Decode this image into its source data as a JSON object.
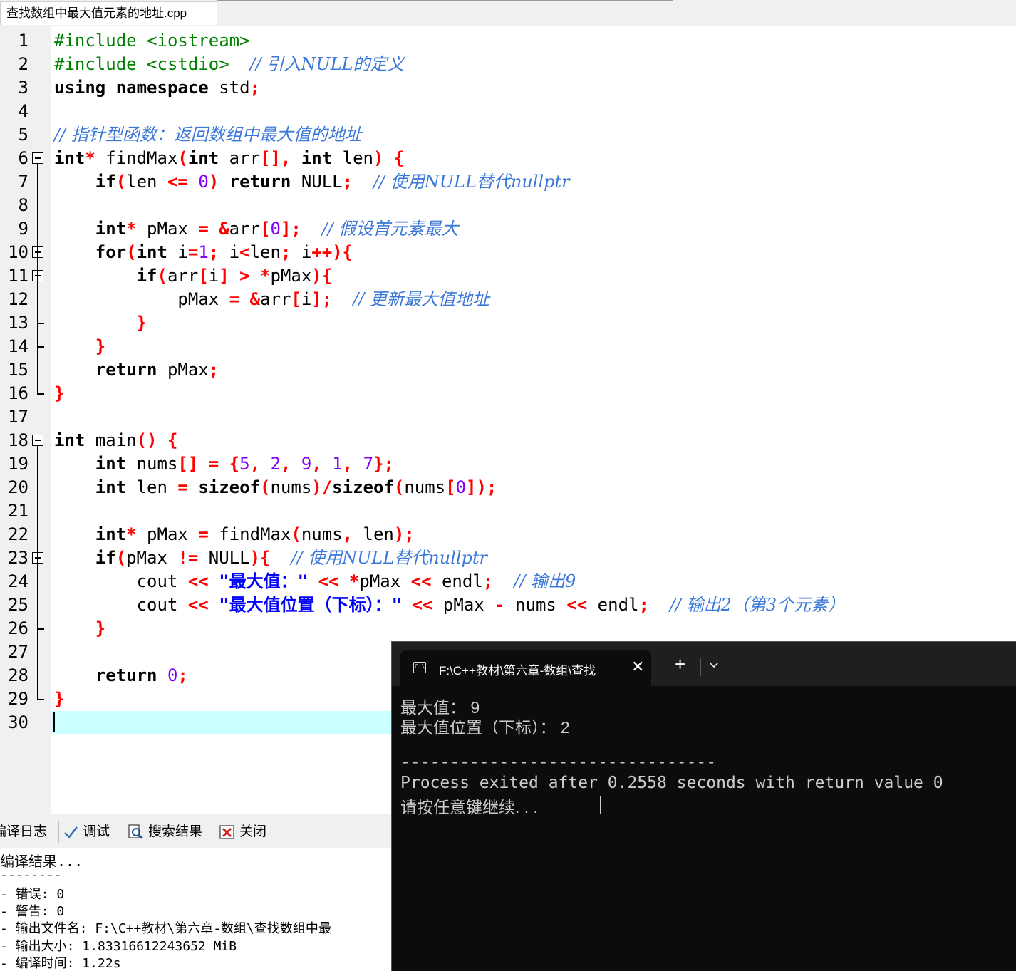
{
  "editor": {
    "tab_title": "查找数组中最大值元素的地址.cpp",
    "lines": [
      {
        "n": "1",
        "t": [
          [
            "pp",
            "#include <iostream>"
          ]
        ]
      },
      {
        "n": "2",
        "t": [
          [
            "pp",
            "#include <cstdio>"
          ],
          [
            "id",
            "  "
          ],
          [
            "cm",
            "// 引入NULL的定义"
          ]
        ]
      },
      {
        "n": "3",
        "t": [
          [
            "kw",
            "using namespace"
          ],
          [
            "id",
            " std"
          ],
          [
            "sym",
            ";"
          ]
        ]
      },
      {
        "n": "4",
        "t": []
      },
      {
        "n": "5",
        "t": [
          [
            "cm",
            "// 指针型函数：返回数组中最大值的地址"
          ]
        ]
      },
      {
        "n": "6",
        "t": [
          [
            "kw",
            "int"
          ],
          [
            "sym",
            "*"
          ],
          [
            "id",
            " findMax"
          ],
          [
            "sym",
            "("
          ],
          [
            "kw",
            "int"
          ],
          [
            "id",
            " arr"
          ],
          [
            "sym",
            "[],"
          ],
          [
            "id",
            " "
          ],
          [
            "kw",
            "int"
          ],
          [
            "id",
            " len"
          ],
          [
            "sym",
            ")"
          ],
          [
            "id",
            " "
          ],
          [
            "sym",
            "{"
          ]
        ]
      },
      {
        "n": "7",
        "t": [
          [
            "id",
            "    "
          ],
          [
            "kw",
            "if"
          ],
          [
            "sym",
            "("
          ],
          [
            "id",
            "len "
          ],
          [
            "sym",
            "<="
          ],
          [
            "id",
            " "
          ],
          [
            "num",
            "0"
          ],
          [
            "sym",
            ")"
          ],
          [
            "id",
            " "
          ],
          [
            "kw",
            "return"
          ],
          [
            "id",
            " NULL"
          ],
          [
            "sym",
            ";"
          ],
          [
            "id",
            "  "
          ],
          [
            "cm",
            "// 使用NULL替代nullptr"
          ]
        ]
      },
      {
        "n": "8",
        "t": []
      },
      {
        "n": "9",
        "t": [
          [
            "id",
            "    "
          ],
          [
            "kw",
            "int"
          ],
          [
            "sym",
            "*"
          ],
          [
            "id",
            " pMax "
          ],
          [
            "sym",
            "="
          ],
          [
            "id",
            " "
          ],
          [
            "sym",
            "&"
          ],
          [
            "id",
            "arr"
          ],
          [
            "sym",
            "["
          ],
          [
            "num",
            "0"
          ],
          [
            "sym",
            "];"
          ],
          [
            "id",
            "  "
          ],
          [
            "cm",
            "// 假设首元素最大"
          ]
        ]
      },
      {
        "n": "10",
        "t": [
          [
            "id",
            "    "
          ],
          [
            "kw",
            "for"
          ],
          [
            "sym",
            "("
          ],
          [
            "kw",
            "int"
          ],
          [
            "id",
            " i"
          ],
          [
            "sym",
            "="
          ],
          [
            "num",
            "1"
          ],
          [
            "sym",
            ";"
          ],
          [
            "id",
            " i"
          ],
          [
            "sym",
            "<"
          ],
          [
            "id",
            "len"
          ],
          [
            "sym",
            ";"
          ],
          [
            "id",
            " i"
          ],
          [
            "sym",
            "++){"
          ]
        ]
      },
      {
        "n": "11",
        "t": [
          [
            "id",
            "        "
          ],
          [
            "kw",
            "if"
          ],
          [
            "sym",
            "("
          ],
          [
            "id",
            "arr"
          ],
          [
            "sym",
            "["
          ],
          [
            "id",
            "i"
          ],
          [
            "sym",
            "]"
          ],
          [
            "id",
            " "
          ],
          [
            "sym",
            ">"
          ],
          [
            "id",
            " "
          ],
          [
            "sym",
            "*"
          ],
          [
            "id",
            "pMax"
          ],
          [
            "sym",
            "){"
          ]
        ]
      },
      {
        "n": "12",
        "t": [
          [
            "id",
            "            pMax "
          ],
          [
            "sym",
            "="
          ],
          [
            "id",
            " "
          ],
          [
            "sym",
            "&"
          ],
          [
            "id",
            "arr"
          ],
          [
            "sym",
            "["
          ],
          [
            "id",
            "i"
          ],
          [
            "sym",
            "];"
          ],
          [
            "id",
            "  "
          ],
          [
            "cm",
            "// 更新最大值地址"
          ]
        ]
      },
      {
        "n": "13",
        "t": [
          [
            "id",
            "        "
          ],
          [
            "sym",
            "}"
          ]
        ]
      },
      {
        "n": "14",
        "t": [
          [
            "id",
            "    "
          ],
          [
            "sym",
            "}"
          ]
        ]
      },
      {
        "n": "15",
        "t": [
          [
            "id",
            "    "
          ],
          [
            "kw",
            "return"
          ],
          [
            "id",
            " pMax"
          ],
          [
            "sym",
            ";"
          ]
        ]
      },
      {
        "n": "16",
        "t": [
          [
            "sym",
            "}"
          ]
        ]
      },
      {
        "n": "17",
        "t": []
      },
      {
        "n": "18",
        "t": [
          [
            "kw",
            "int"
          ],
          [
            "id",
            " main"
          ],
          [
            "sym",
            "()"
          ],
          [
            "id",
            " "
          ],
          [
            "sym",
            "{"
          ]
        ]
      },
      {
        "n": "19",
        "t": [
          [
            "id",
            "    "
          ],
          [
            "kw",
            "int"
          ],
          [
            "id",
            " nums"
          ],
          [
            "sym",
            "[]"
          ],
          [
            "id",
            " "
          ],
          [
            "sym",
            "="
          ],
          [
            "id",
            " "
          ],
          [
            "sym",
            "{"
          ],
          [
            "num",
            "5"
          ],
          [
            "sym",
            ","
          ],
          [
            "id",
            " "
          ],
          [
            "num",
            "2"
          ],
          [
            "sym",
            ","
          ],
          [
            "id",
            " "
          ],
          [
            "num",
            "9"
          ],
          [
            "sym",
            ","
          ],
          [
            "id",
            " "
          ],
          [
            "num",
            "1"
          ],
          [
            "sym",
            ","
          ],
          [
            "id",
            " "
          ],
          [
            "num",
            "7"
          ],
          [
            "sym",
            "};"
          ]
        ]
      },
      {
        "n": "20",
        "t": [
          [
            "id",
            "    "
          ],
          [
            "kw",
            "int"
          ],
          [
            "id",
            " len "
          ],
          [
            "sym",
            "="
          ],
          [
            "id",
            " "
          ],
          [
            "kw",
            "sizeof"
          ],
          [
            "sym",
            "("
          ],
          [
            "id",
            "nums"
          ],
          [
            "sym",
            ")/"
          ],
          [
            "kw",
            "sizeof"
          ],
          [
            "sym",
            "("
          ],
          [
            "id",
            "nums"
          ],
          [
            "sym",
            "["
          ],
          [
            "num",
            "0"
          ],
          [
            "sym",
            "]);"
          ]
        ]
      },
      {
        "n": "21",
        "t": []
      },
      {
        "n": "22",
        "t": [
          [
            "id",
            "    "
          ],
          [
            "kw",
            "int"
          ],
          [
            "sym",
            "*"
          ],
          [
            "id",
            " pMax "
          ],
          [
            "sym",
            "="
          ],
          [
            "id",
            " findMax"
          ],
          [
            "sym",
            "("
          ],
          [
            "id",
            "nums"
          ],
          [
            "sym",
            ","
          ],
          [
            "id",
            " len"
          ],
          [
            "sym",
            ");"
          ]
        ]
      },
      {
        "n": "23",
        "t": [
          [
            "id",
            "    "
          ],
          [
            "kw",
            "if"
          ],
          [
            "sym",
            "("
          ],
          [
            "id",
            "pMax "
          ],
          [
            "sym",
            "!="
          ],
          [
            "id",
            " NULL"
          ],
          [
            "sym",
            "){"
          ],
          [
            "id",
            "  "
          ],
          [
            "cm",
            "// 使用NULL替代nullptr"
          ]
        ]
      },
      {
        "n": "24",
        "t": [
          [
            "id",
            "        cout "
          ],
          [
            "sym",
            "<<"
          ],
          [
            "id",
            " "
          ],
          [
            "str",
            "\"最大值：\""
          ],
          [
            "id",
            " "
          ],
          [
            "sym",
            "<<"
          ],
          [
            "id",
            " "
          ],
          [
            "sym",
            "*"
          ],
          [
            "id",
            "pMax "
          ],
          [
            "sym",
            "<<"
          ],
          [
            "id",
            " endl"
          ],
          [
            "sym",
            ";"
          ],
          [
            "id",
            "  "
          ],
          [
            "cm",
            "// 输出9"
          ]
        ]
      },
      {
        "n": "25",
        "t": [
          [
            "id",
            "        cout "
          ],
          [
            "sym",
            "<<"
          ],
          [
            "id",
            " "
          ],
          [
            "str",
            "\"最大值位置（下标）：\""
          ],
          [
            "id",
            " "
          ],
          [
            "sym",
            "<<"
          ],
          [
            "id",
            " pMax "
          ],
          [
            "sym",
            "-"
          ],
          [
            "id",
            " nums "
          ],
          [
            "sym",
            "<<"
          ],
          [
            "id",
            " endl"
          ],
          [
            "sym",
            ";"
          ],
          [
            "id",
            "  "
          ],
          [
            "cm",
            "// 输出2（第3个元素）"
          ]
        ]
      },
      {
        "n": "26",
        "t": [
          [
            "id",
            "    "
          ],
          [
            "sym",
            "}"
          ]
        ]
      },
      {
        "n": "27",
        "t": []
      },
      {
        "n": "28",
        "t": [
          [
            "id",
            "    "
          ],
          [
            "kw",
            "return"
          ],
          [
            "id",
            " "
          ],
          [
            "num",
            "0"
          ],
          [
            "sym",
            ";"
          ]
        ]
      },
      {
        "n": "29",
        "t": [
          [
            "sym",
            "}"
          ]
        ]
      },
      {
        "n": "30",
        "t": []
      }
    ]
  },
  "bottom_panel": {
    "tabs": [
      {
        "label": "编译日志",
        "icon": "compile-log-icon"
      },
      {
        "label": "调试",
        "icon": "check-icon"
      },
      {
        "label": "搜索结果",
        "icon": "search-icon"
      },
      {
        "label": "关闭",
        "icon": "close-icon"
      }
    ],
    "log": [
      "编译结果...",
      "--------",
      "- 错误: 0",
      "- 警告: 0",
      "- 输出文件名: F:\\C++教材\\第六章-数组\\查找数组中最",
      "- 输出大小: 1.83316612243652 MiB",
      "- 编译时间: 1.22s"
    ]
  },
  "console": {
    "tab_title": "F:\\C++教材\\第六章-数组\\查找",
    "close_glyph": "✕",
    "new_tab_glyph": "+",
    "output": [
      "最大值： 9",
      "最大值位置（下标）： 2",
      "",
      "--------------------------------",
      "Process exited after 0.2558 seconds with return value 0",
      "请按任意键继续. . ."
    ]
  }
}
